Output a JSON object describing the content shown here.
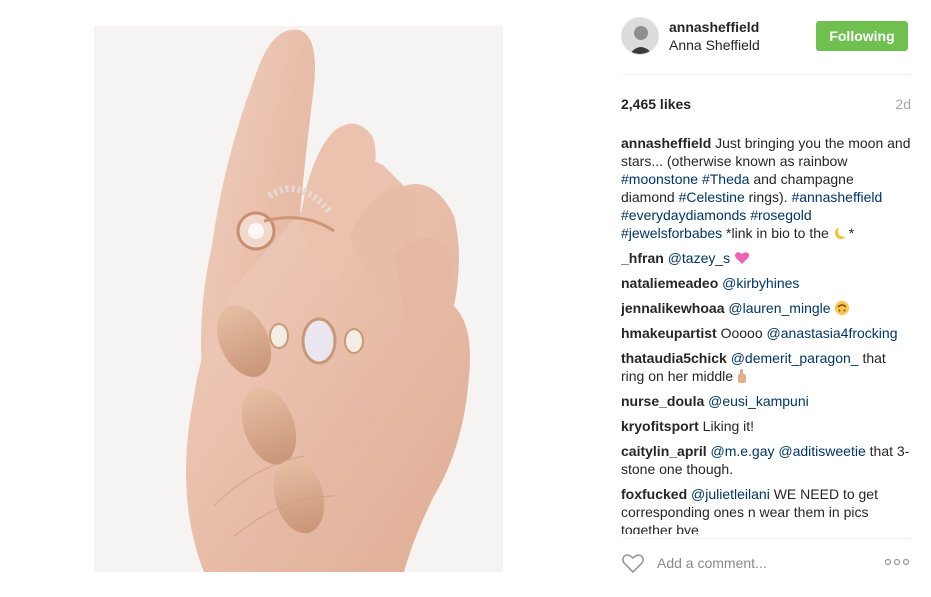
{
  "post": {
    "image_alt": "Hand wearing rose gold rings"
  },
  "header": {
    "username": "annasheffield",
    "full_name": "Anna Sheffield",
    "follow_label": "Following",
    "follow_color": "#70c050"
  },
  "stats": {
    "likes": "2,465 likes",
    "time_ago": "2d"
  },
  "caption": {
    "user": "annasheffield",
    "t1": " Just bringing you the moon and stars... (otherwise known as rainbow ",
    "tag1": "#moonstone",
    "t2": " ",
    "tag2": "#Theda",
    "t3": " and champagne diamond ",
    "tag3": "#Celestine",
    "t4": " rings). ",
    "tag4": "#annasheffield",
    "t5": " ",
    "tag5": "#everydaydiamonds",
    "t6": " ",
    "tag6": "#rosegold",
    "t7": " ",
    "tag7": "#jewelsforbabes",
    "t8": " *link in bio to the ",
    "t9": "*"
  },
  "comments": [
    {
      "user": "_hfran",
      "mention": "@tazey_s",
      "emoji": "heart"
    },
    {
      "user": "nataliemeadeo",
      "mention": "@kirbyhines"
    },
    {
      "user": "jennalikewhoaa",
      "mention": "@lauren_mingle",
      "emoji": "upside-down-face"
    },
    {
      "user": "hmakeupartist",
      "text": " Ooooo ",
      "mention": "@anastasia4frocking"
    },
    {
      "user": "thataudia5chick",
      "mention": "@demerit_paragon_",
      "text": " that ring on her middle",
      "emoji": "pointing-hand"
    },
    {
      "user": "nurse_doula",
      "mention": "@eusi_kampuni"
    },
    {
      "user": "kryofitsport",
      "text": " Liking it!"
    },
    {
      "user": "caitylin_april",
      "mention": "@m.e.gay",
      "mention2": "@aditisweetie",
      "text": " that 3-stone one though."
    },
    {
      "user": "foxfucked",
      "mention": "@julietleilani",
      "text": " WE NEED to get corresponding ones n wear them in pics together bye"
    }
  ],
  "add_comment": {
    "placeholder": "Add a comment..."
  },
  "icons": {
    "like": "heart-outline-icon",
    "more": "more-options-icon"
  }
}
